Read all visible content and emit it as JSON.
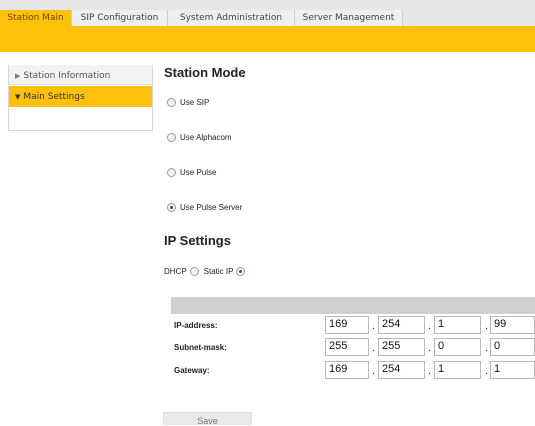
{
  "tabs": [
    "Station Main",
    "SIP Configuration",
    "System Administration",
    "Server Management"
  ],
  "sidebar": {
    "items": [
      {
        "label": "Station Information",
        "active": false
      },
      {
        "label": "Main Settings",
        "active": true
      }
    ]
  },
  "station_mode": {
    "title": "Station Mode",
    "options": [
      {
        "label": "Use SIP",
        "checked": false
      },
      {
        "label": "Use Alphacom",
        "checked": false
      },
      {
        "label": "Use Pulse",
        "checked": false
      },
      {
        "label": "Use Pulse Server",
        "checked": true
      }
    ]
  },
  "ip_settings": {
    "title": "IP Settings",
    "dhcp_label": "DHCP",
    "static_label": "Static IP",
    "dhcp_checked": false,
    "static_checked": true,
    "rows": [
      {
        "label": "IP-address:",
        "octets": [
          "169",
          "254",
          "1",
          "99"
        ]
      },
      {
        "label": "Subnet-mask:",
        "octets": [
          "255",
          "255",
          "0",
          "0"
        ]
      },
      {
        "label": "Gateway:",
        "octets": [
          "169",
          "254",
          "1",
          "1"
        ]
      }
    ]
  },
  "save_label": "Save",
  "colors": {
    "accent": "#ffc107",
    "tabbar": "#e6e6e6",
    "radio_dot": "#2a4fb8"
  }
}
